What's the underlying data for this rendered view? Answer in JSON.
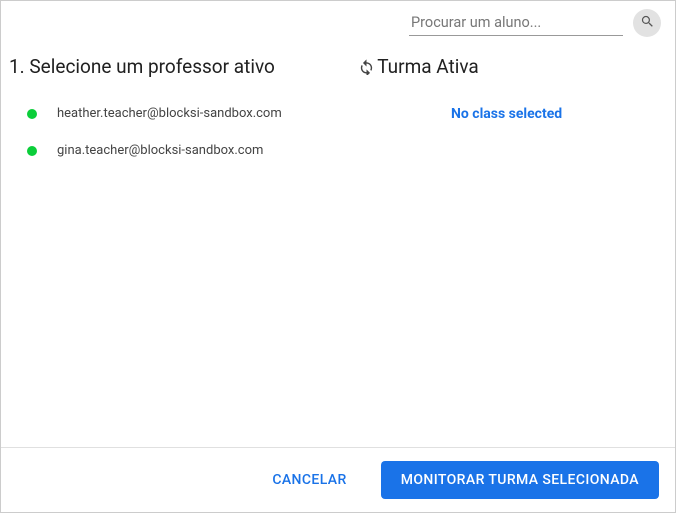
{
  "search": {
    "placeholder": "Procurar um aluno..."
  },
  "sections": {
    "select_teacher_title": "1. Selecione um professor ativo",
    "active_class_title": "Turma Ativa"
  },
  "teachers": [
    {
      "status": "online",
      "email": "heather.teacher@blocksi-sandbox.com"
    },
    {
      "status": "online",
      "email": "gina.teacher@blocksi-sandbox.com"
    }
  ],
  "active_class": {
    "empty_message": "No class selected"
  },
  "footer": {
    "cancel_label": "CANCELAR",
    "monitor_label": "MONITORAR TURMA SELECIONADA"
  },
  "colors": {
    "primary": "#1a73e8",
    "online": "#0bce3a"
  }
}
